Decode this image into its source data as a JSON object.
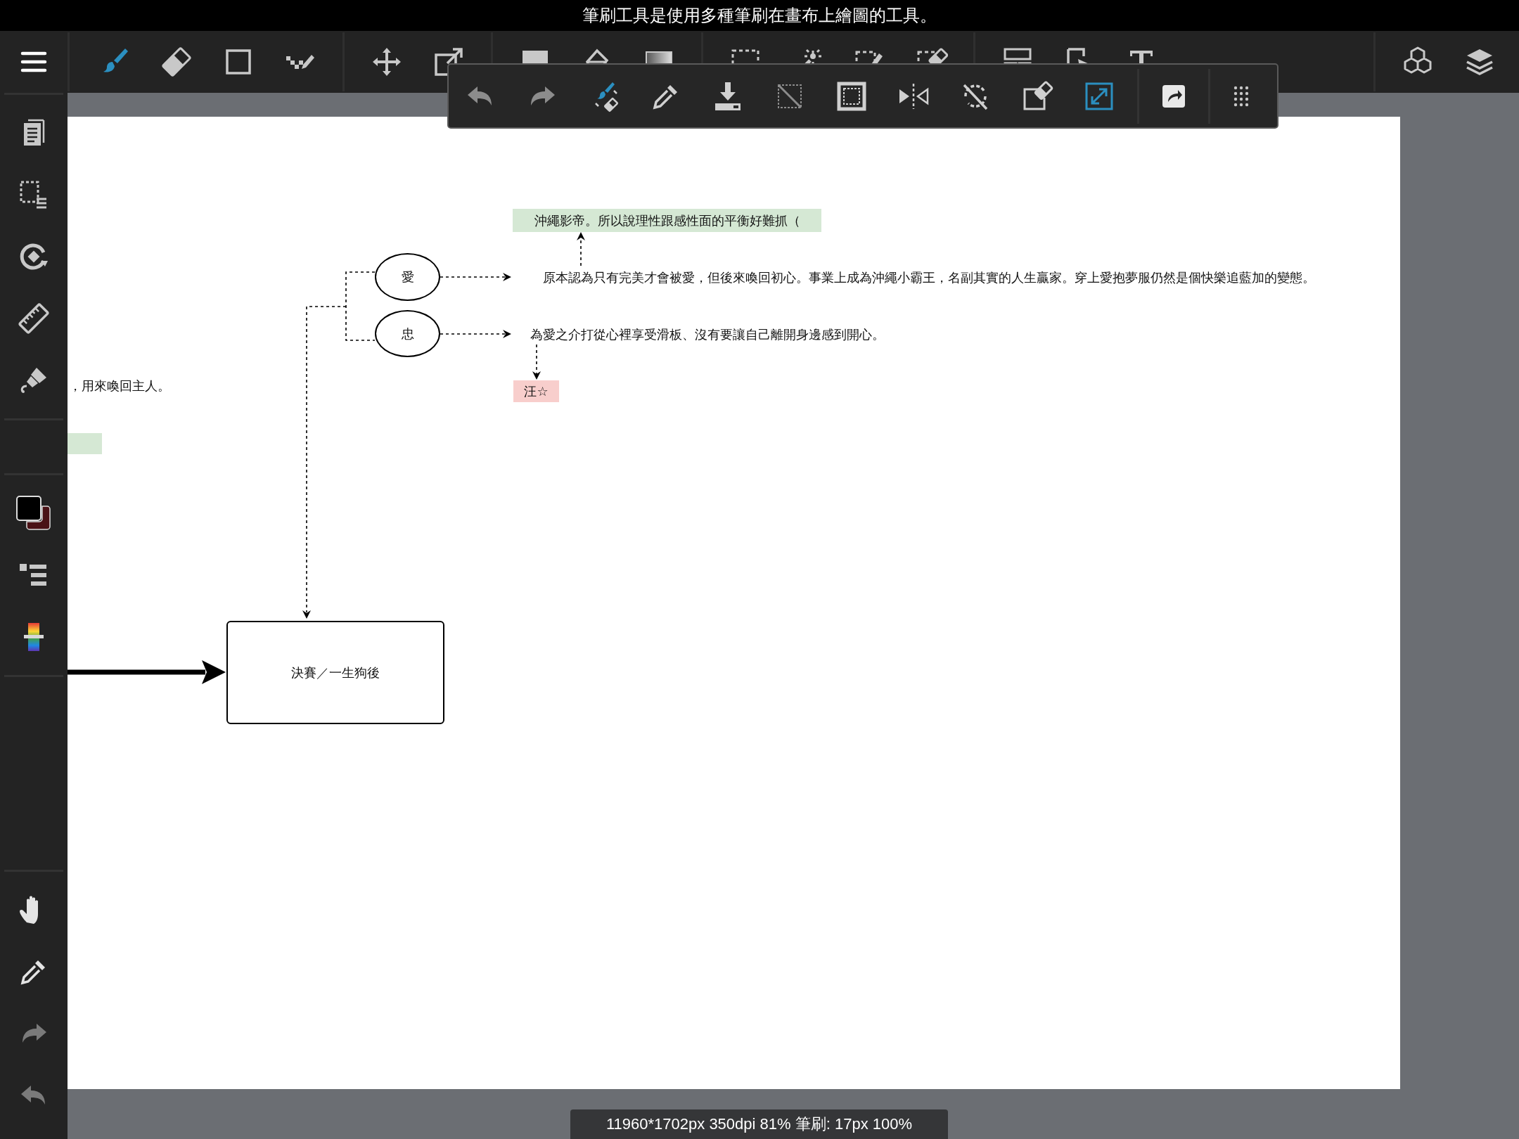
{
  "hint_bar": {
    "text": "筆刷工具是使用多種筆刷在畫布上繪圖的工具。"
  },
  "toolbar": {
    "tools": [
      {
        "selected": true
      },
      {
        "selected": false
      },
      {
        "selected": false
      },
      {
        "selected": false
      },
      {
        "selected": false
      },
      {
        "selected": false
      },
      {
        "selected": false
      },
      {
        "selected": false
      },
      {
        "selected": false
      },
      {
        "selected": false
      },
      {
        "selected": false
      },
      {
        "selected": false
      },
      {
        "selected": false
      },
      {
        "selected": false
      },
      {
        "selected": false
      },
      {
        "selected": false
      }
    ]
  },
  "floating_toolbar": {
    "items": [
      {
        "on": false,
        "disabled": true
      },
      {
        "on": false,
        "disabled": true
      },
      {
        "on": false,
        "disabled": false
      },
      {
        "on": false,
        "disabled": false
      },
      {
        "on": false,
        "disabled": false
      },
      {
        "on": false,
        "disabled": true
      },
      {
        "on": false,
        "disabled": false
      },
      {
        "on": false,
        "disabled": false
      },
      {
        "on": false,
        "disabled": false
      },
      {
        "on": false,
        "disabled": false
      },
      {
        "on": true,
        "disabled": false
      }
    ]
  },
  "sidebar": {
    "swatches": [
      {
        "color": "#000000"
      },
      {
        "color": "#4a1216"
      }
    ],
    "bottom_tools": [
      {
        "disabled": false
      },
      {
        "disabled": false
      },
      {
        "disabled": true
      },
      {
        "disabled": true
      }
    ]
  },
  "canvas": {
    "nodes": [
      {
        "kind": "label",
        "text": "沖繩影帝。所以說理性跟感性面的平衡好難抓（",
        "color": "#d5e8d4"
      },
      {
        "kind": "text",
        "text": "原本認為只有完美才會被愛，但後來喚回初心。事業上成為沖繩小霸王，名副其實的人生贏家。穿上愛抱夢服仍然是個快樂追藍加的變態。"
      },
      {
        "kind": "text",
        "text": "為愛之介打從心裡享受滑板、沒有要讓自己離開身邊感到開心。"
      },
      {
        "kind": "text",
        "text": "，用來喚回主人。"
      },
      {
        "kind": "label",
        "text": "汪☆",
        "color": "#f8cecc"
      },
      {
        "kind": "label",
        "color": "#d5e8d4"
      },
      {
        "kind": "ellipse",
        "text": "愛"
      },
      {
        "kind": "ellipse",
        "text": "忠"
      },
      {
        "kind": "box",
        "text": "決賽／一生狗後"
      }
    ]
  },
  "status_bar": {
    "text": "11960*1702px 350dpi 81% 筆刷: 17px 100%"
  }
}
